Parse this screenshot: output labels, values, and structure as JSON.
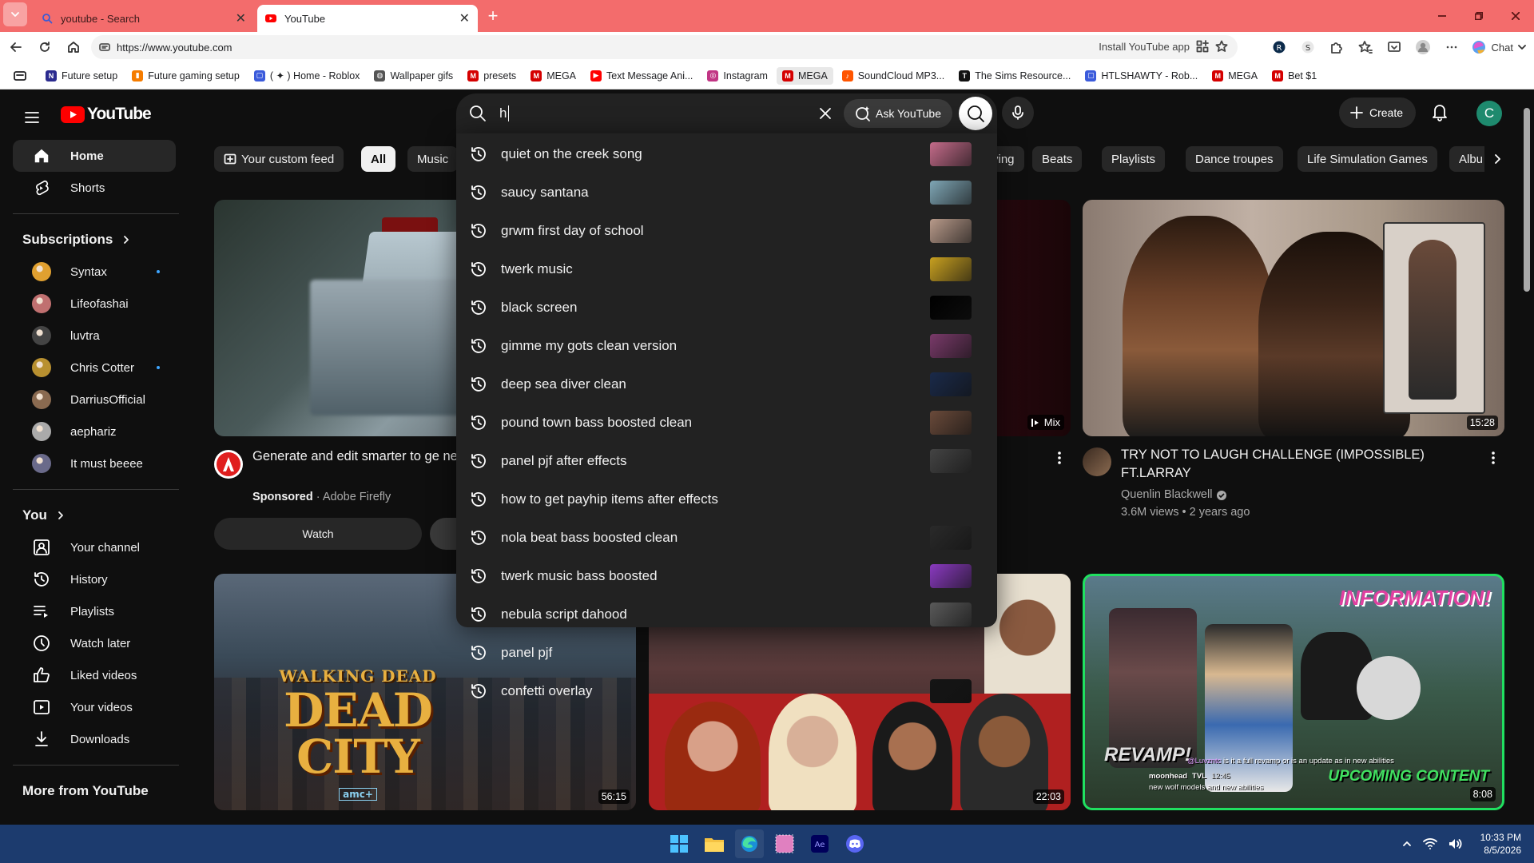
{
  "browser": {
    "tabs": [
      {
        "title": "youtube - Search",
        "active": false
      },
      {
        "title": "YouTube",
        "active": true
      }
    ],
    "url": "https://www.youtube.com",
    "install_app": "Install YouTube app",
    "chat_label": "Chat"
  },
  "bookmarks": [
    {
      "label": "Future setup",
      "color": "#2b2b8f",
      "glyph": "N"
    },
    {
      "label": "Future gaming setup",
      "color": "#f57c00",
      "glyph": "▮"
    },
    {
      "label": "( ✦ ) Home - Roblox",
      "color": "#3b5bdb",
      "glyph": "▢"
    },
    {
      "label": "Wallpaper gifs",
      "color": "#555555",
      "glyph": "◍"
    },
    {
      "label": "presets",
      "color": "#d50000",
      "glyph": "M"
    },
    {
      "label": "MEGA",
      "color": "#d50000",
      "glyph": "M"
    },
    {
      "label": "Text Message Ani...",
      "color": "#ff0000",
      "glyph": "▶"
    },
    {
      "label": "Instagram",
      "color": "#c13584",
      "glyph": "◎"
    },
    {
      "label": "MEGA",
      "color": "#d50000",
      "glyph": "M"
    },
    {
      "label": "SoundCloud MP3...",
      "color": "#ff5500",
      "glyph": "♪"
    },
    {
      "label": "The Sims Resource...",
      "color": "#111111",
      "glyph": "T"
    },
    {
      "label": "HTLSHAWTY - Rob...",
      "color": "#3b5bdb",
      "glyph": "▢"
    },
    {
      "label": "MEGA",
      "color": "#d50000",
      "glyph": "M"
    },
    {
      "label": "Bet $1",
      "color": "#d50000",
      "glyph": "M"
    }
  ],
  "youtube": {
    "logo_text": "YouTube",
    "search": {
      "value": "h",
      "ask_label": "Ask YouTube"
    },
    "create_label": "Create",
    "avatar_letter": "C",
    "suggestions": [
      {
        "text": "quiet on the creek song",
        "thumb": "#c46b8a"
      },
      {
        "text": "saucy santana",
        "thumb": "#7fa6b5"
      },
      {
        "text": "grwm first day of school",
        "thumb": "#b89a8a"
      },
      {
        "text": "twerk music",
        "thumb": "#c8a020"
      },
      {
        "text": "black screen",
        "thumb": "#000000"
      },
      {
        "text": "gimme my gots clean version",
        "thumb": "#7a3a6a"
      },
      {
        "text": "deep sea diver clean",
        "thumb": "#1a2a4a"
      },
      {
        "text": "pound town bass boosted clean",
        "thumb": "#6a4a3a"
      },
      {
        "text": "panel pjf after effects",
        "thumb": "#444444"
      },
      {
        "text": "how to get payhip items after effects",
        "thumb": ""
      },
      {
        "text": "nola beat bass boosted clean",
        "thumb": "#2a2a2a"
      },
      {
        "text": "twerk music bass boosted",
        "thumb": "#8a3ac0"
      },
      {
        "text": "nebula script dahood",
        "thumb": "#5a5a5a"
      },
      {
        "text": "panel pjf",
        "thumb": ""
      },
      {
        "text": "confetti overlay",
        "thumb": "#151515"
      }
    ],
    "sidebar": {
      "main": [
        {
          "label": "Home",
          "icon": "home-icon",
          "active": true
        },
        {
          "label": "Shorts",
          "icon": "shorts-icon",
          "active": false
        }
      ],
      "subscriptions_title": "Subscriptions",
      "subscriptions": [
        {
          "name": "Syntax",
          "color": "#e0a030",
          "dot": true
        },
        {
          "name": "Lifeofashai",
          "color": "#c07070",
          "dot": false
        },
        {
          "name": "luvtra",
          "color": "#444444",
          "dot": false
        },
        {
          "name": "Chris Cotter",
          "color": "#b89030",
          "dot": true
        },
        {
          "name": "DarriusOfficial",
          "color": "#8a6a50",
          "dot": false
        },
        {
          "name": "aephariz",
          "color": "#aaaaaa",
          "dot": false
        },
        {
          "name": "It must beeee",
          "color": "#6a6a8a",
          "dot": false
        }
      ],
      "you_title": "You",
      "you_items": [
        {
          "label": "Your channel",
          "icon": "channel-icon"
        },
        {
          "label": "History",
          "icon": "history-icon"
        },
        {
          "label": "Playlists",
          "icon": "playlists-icon"
        },
        {
          "label": "Watch later",
          "icon": "watch-later-icon"
        },
        {
          "label": "Liked videos",
          "icon": "like-icon"
        },
        {
          "label": "Your videos",
          "icon": "your-videos-icon"
        },
        {
          "label": "Downloads",
          "icon": "download-icon"
        }
      ],
      "more_title": "More from YouTube"
    },
    "chips": [
      "Your custom feed",
      "All",
      "Music",
      "ying",
      "Beats",
      "Playlists",
      "Dance troupes",
      "Life Simulation Games",
      "Albu"
    ],
    "videos": {
      "ad": {
        "title": "Generate and edit smarter to ge next social post",
        "sponsored": "Sponsored",
        "advertiser": "Adobe Firefly",
        "watch_label": "Watch"
      },
      "mix_label": "Mix",
      "v3": {
        "title": "TRY NOT TO LAUGH CHALLENGE (IMPOSSIBLE) FT.LARRAY",
        "channel": "Quenlin Blackwell",
        "meta": "3.6M views • 2 years ago",
        "duration": "15:28"
      },
      "row2": [
        {
          "duration": "56:15",
          "overlay_line1": "WALKING DEAD",
          "overlay_line2": "DEAD CITY",
          "overlay_brand": "amc+"
        },
        {
          "duration": "22:03"
        },
        {
          "duration": "8:08",
          "overlay_top": "INFORMATION!",
          "overlay_left": "REVAMP!",
          "overlay_right": "UPCOMING CONTENT",
          "comment_user": "@Luvzntc",
          "comment_text": "is it a full revamp or is an update as in new abilities",
          "reply_user": "moonhead",
          "reply_tag": "TVL",
          "reply_time": "12:45",
          "reply_text": "new wolf models and new abilities"
        }
      ]
    }
  },
  "taskbar": {
    "time": "10:33 PM",
    "date": "8/5/2026"
  }
}
